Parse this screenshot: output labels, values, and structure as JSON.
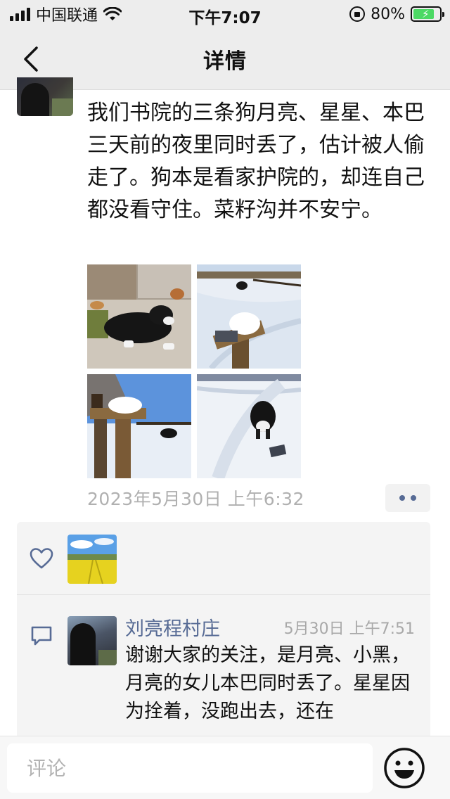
{
  "status_bar": {
    "carrier": "中国联通",
    "time": "下午7:07",
    "battery": "80%",
    "battery_level": 0.8
  },
  "nav": {
    "title": "详情"
  },
  "post": {
    "text": "我们书院的三条狗月亮、星星、本巴三天前的夜里同时丢了，估计被人偷走了。狗本是看家护院的，却连自己都没看守住。菜籽沟并不安宁。",
    "time": "2023年5月30日 上午6:32",
    "photo_count": 4
  },
  "comment": {
    "author": "刘亮程村庄",
    "time": "5月30日 上午7:51",
    "text": "谢谢大家的关注，是月亮、小黑，月亮的女儿本巴同时丢了。星星因为拴着，没跑出去，还在"
  },
  "bottom_bar": {
    "comment_placeholder": "评论"
  },
  "colors": {
    "link_blue": "#576b95",
    "bar_gray": "#ededed",
    "panel_gray": "#f4f4f4",
    "battery_green": "#4cd964"
  }
}
